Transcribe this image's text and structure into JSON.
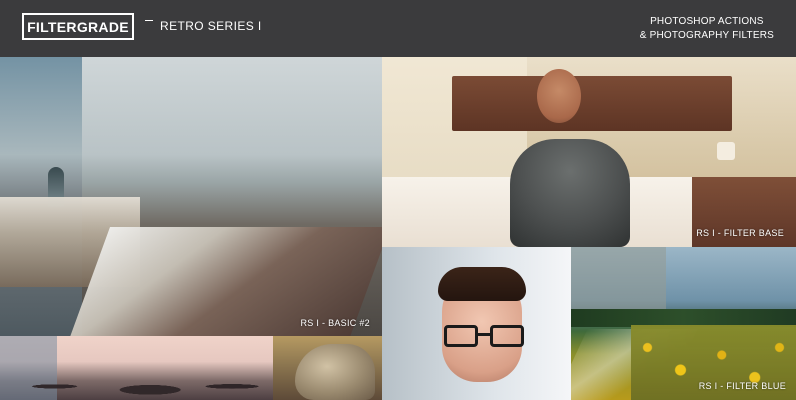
{
  "header": {
    "logo": "FILTERGRADE",
    "series_title": "RETRO SERIES I",
    "tagline_line1": "PHOTOSHOP ACTIONS",
    "tagline_line2": "& PHOTOGRAPHY FILTERS",
    "background": "#3b3b3d",
    "text_color": "#ffffff"
  },
  "tiles": {
    "city": {
      "caption": "RS I - BASIC #2"
    },
    "bedroom": {
      "caption": "RS I - FILTER BASE"
    },
    "field": {
      "caption": "RS I - FILTER BLUE"
    }
  }
}
